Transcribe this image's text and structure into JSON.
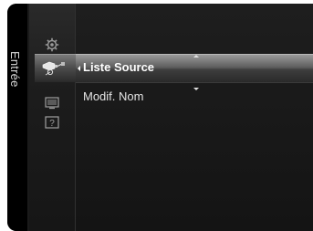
{
  "sidebar": {
    "tab_label": "Entrée",
    "icons": [
      {
        "name": "gear-icon",
        "selected": false
      },
      {
        "name": "input-source-icon",
        "selected": true
      },
      {
        "name": "picture-icon",
        "selected": false
      },
      {
        "name": "help-icon",
        "selected": false
      }
    ]
  },
  "menu": {
    "items": [
      {
        "label": "Liste Source",
        "selected": true
      },
      {
        "label": "Modif. Nom",
        "selected": false
      }
    ]
  },
  "colors": {
    "background": "#1a1a1a",
    "highlight": "#6a6a6a",
    "text": "#ffffff"
  }
}
